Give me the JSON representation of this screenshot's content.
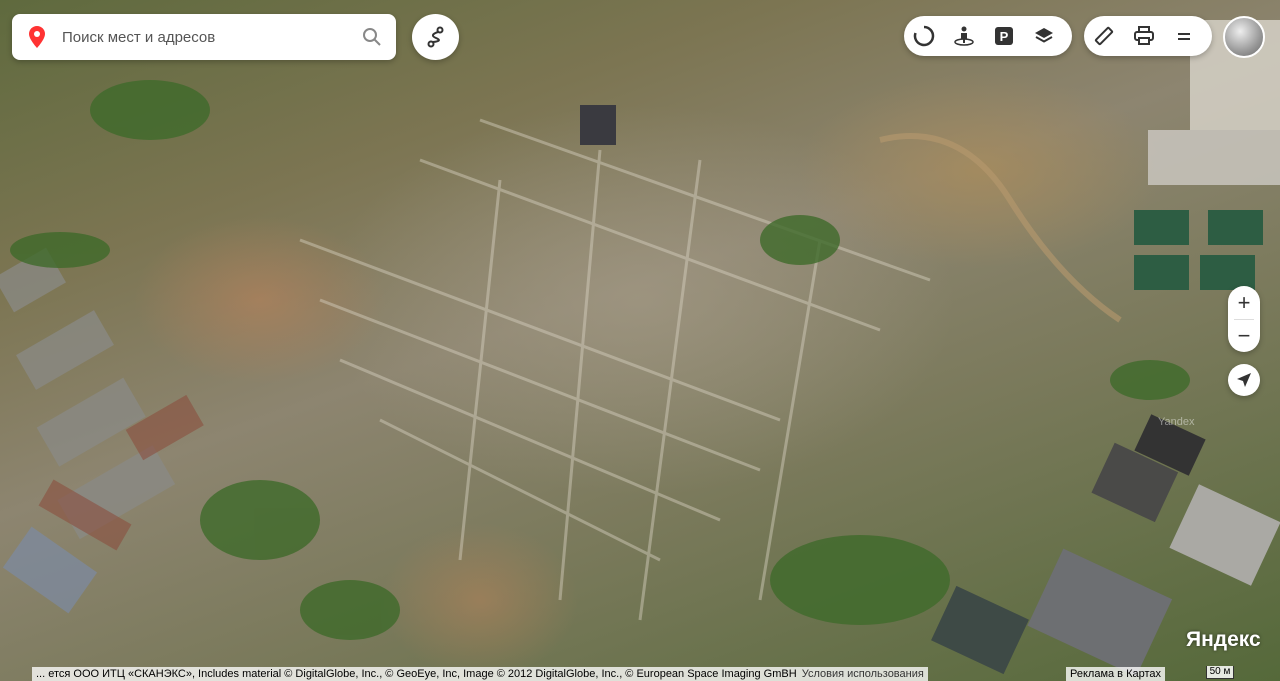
{
  "search": {
    "placeholder": "Поиск мест и адресов"
  },
  "icons": {
    "location": "location-pin-icon",
    "search": "search-icon",
    "route": "route-icon",
    "traffic": "traffic-icon",
    "panorama": "panorama-icon",
    "parking": "parking-icon",
    "layers": "layers-icon",
    "ruler": "ruler-icon",
    "print": "print-icon",
    "menu": "menu-icon",
    "locate": "locate-arrow-icon"
  },
  "controls": {
    "parking_label": "P",
    "zoom_in": "+",
    "zoom_out": "−"
  },
  "footer": {
    "copyright": "... ется ООО ИТЦ «СКАНЭКС», Includes material © DigitalGlobe, Inc., © GeoEye, Inc, Image © 2012 DigitalGlobe, Inc., © European Space Imaging GmBH",
    "terms": "Условия использования",
    "ads": "Реклама в Картах",
    "scale": "50 м",
    "logo": "Яндекс",
    "watermark": "Yandex"
  },
  "colors": {
    "accent": "#f33",
    "brand": "#ff0000"
  }
}
